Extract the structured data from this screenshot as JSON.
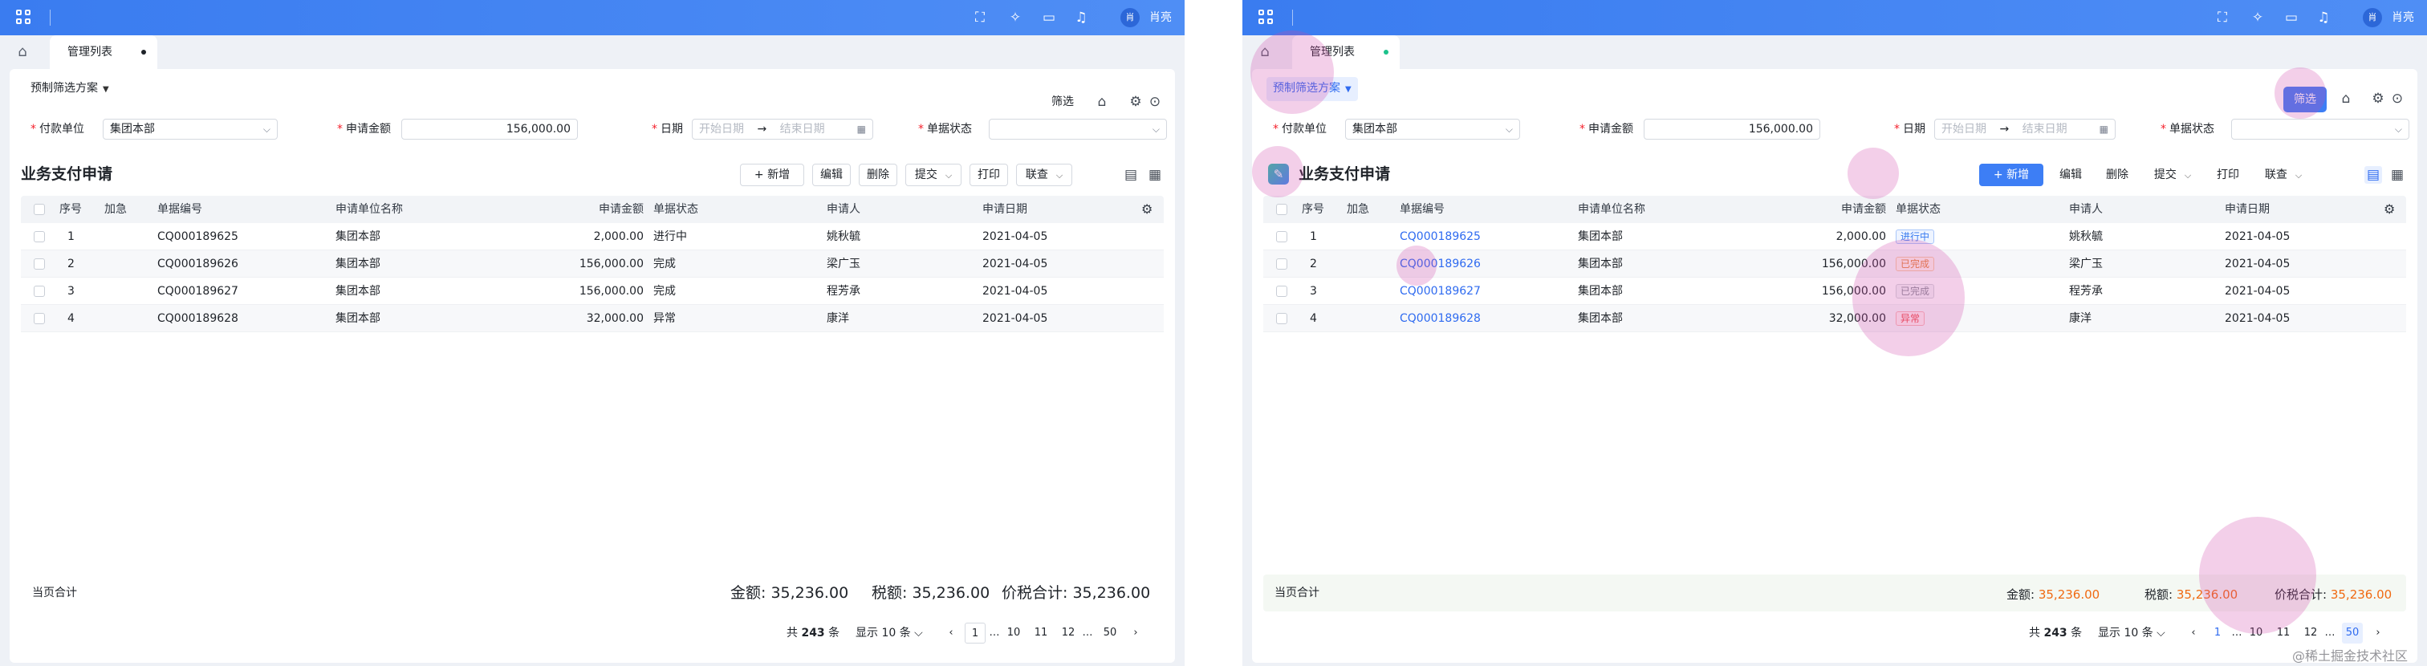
{
  "header": {
    "user_name": "肖亮",
    "avatar_text": "肖"
  },
  "tab": {
    "home_label": "",
    "label": "管理列表"
  },
  "toolbar": {
    "scheme_label": "预制筛选方案",
    "filter_label": "筛选"
  },
  "form": {
    "payer_label": "付款单位",
    "payer_value": "集团本部",
    "amount_label": "申请金额",
    "amount_value": "156,000.00",
    "date_label": "日期",
    "date_start_placeholder": "开始日期",
    "date_end_placeholder": "结束日期",
    "date_arrow": "→",
    "status_label": "单据状态",
    "status_value": ""
  },
  "section": {
    "title": "业务支付申请"
  },
  "actions": {
    "add": "新增",
    "edit": "编辑",
    "delete": "删除",
    "submit": "提交",
    "print": "打印",
    "query": "联查"
  },
  "table": {
    "columns": {
      "seq": "序号",
      "urgent": "加急",
      "doc_no": "单据编号",
      "unit_name": "申请单位名称",
      "amount": "申请金额",
      "status": "单据状态",
      "applicant": "申请人",
      "date": "申请日期"
    },
    "rows": [
      {
        "seq": "1",
        "doc_no": "CQ000189625",
        "unit_name": "集团本部",
        "amount": "2,000.00",
        "status": "进行中",
        "status_tag": "进行中",
        "status_color": "#3a7cf0",
        "applicant": "姚秋毓",
        "date": "2021-04-05"
      },
      {
        "seq": "2",
        "doc_no": "CQ000189626",
        "unit_name": "集团本部",
        "amount": "156,000.00",
        "status": "完成",
        "status_tag": "已完成",
        "status_color": "#e7843a",
        "applicant": "梁广玉",
        "date": "2021-04-05"
      },
      {
        "seq": "3",
        "doc_no": "CQ000189627",
        "unit_name": "集团本部",
        "amount": "156,000.00",
        "status": "完成",
        "status_tag": "已完成",
        "status_color": "#8a8f99",
        "applicant": "程芳承",
        "date": "2021-04-05"
      },
      {
        "seq": "4",
        "doc_no": "CQ000189628",
        "unit_name": "集团本部",
        "amount": "32,000.00",
        "status": "异常",
        "status_tag": "异常",
        "status_color": "#ef4b4b",
        "applicant": "康洋",
        "date": "2021-04-05"
      }
    ]
  },
  "summary": {
    "page_total_label": "当页合计",
    "amount_label": "金额:",
    "amount_value": "35,236.00",
    "tax_label": "税额:",
    "tax_value": "35,236.00",
    "total_label": "价税合计:",
    "total_value": "35,236.00"
  },
  "pager": {
    "total_text": "共",
    "total_count": "243",
    "total_unit": "条",
    "size_label": "显示 10 条",
    "pages_left": [
      "1",
      "…",
      "10",
      "11",
      "12",
      "…",
      "50"
    ],
    "pages_right": [
      "1",
      "…",
      "10",
      "11",
      "12",
      "…",
      "50"
    ]
  },
  "watermark": "@稀土掘金技术社区",
  "colors": {
    "topbar": "#3a7cf0",
    "primary": "#3d7ef5",
    "highlight_circle": "#d246aa",
    "amount_orange": "#f06a12"
  }
}
